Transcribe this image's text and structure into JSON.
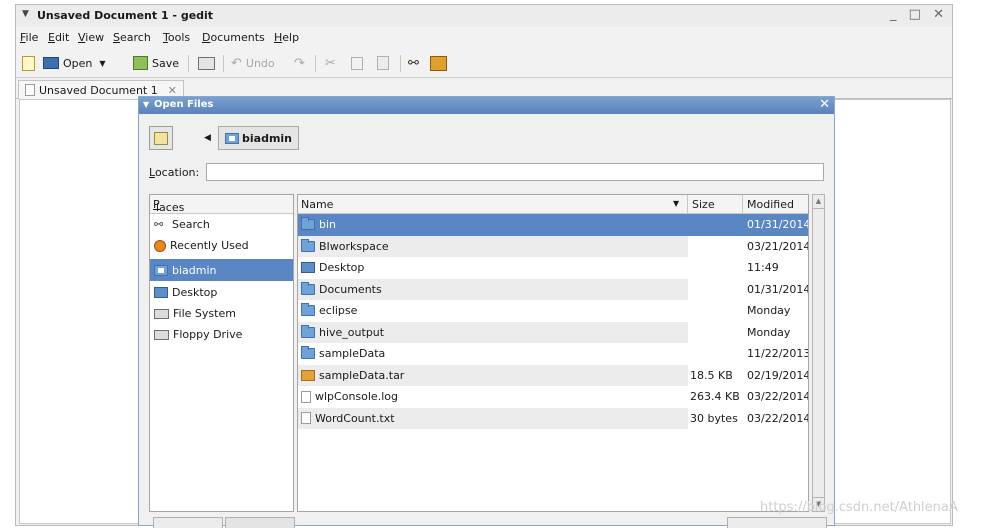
{
  "window": {
    "title": "Unsaved Document 1 - gedit",
    "controls": "_ □ ✕"
  },
  "menubar": [
    {
      "accel": "F",
      "rest": "ile"
    },
    {
      "accel": "E",
      "rest": "dit"
    },
    {
      "accel": "V",
      "rest": "iew"
    },
    {
      "accel": "S",
      "rest": "earch"
    },
    {
      "accel": "T",
      "rest": "ools"
    },
    {
      "accel": "D",
      "rest": "ocuments"
    },
    {
      "accel": "H",
      "rest": "elp"
    }
  ],
  "toolbar": {
    "open_label": "Open",
    "save_label": "Save",
    "undo_label": "Undo"
  },
  "tab": {
    "label": "Unsaved Document 1",
    "close": "✕"
  },
  "dialog": {
    "title": "Open Files",
    "close": "✕",
    "path_button": "biadmin",
    "location_label_accel": "L",
    "location_label_rest": "ocation:",
    "location_value": "",
    "places_header_accel": "P",
    "places_header_rest": "laces",
    "places": [
      {
        "label": "Search",
        "icon": "search-icon"
      },
      {
        "label": "Recently Used",
        "icon": "recent-icon"
      },
      {
        "label": "biadmin",
        "icon": "home-folder-icon",
        "selected": true
      },
      {
        "label": "Desktop",
        "icon": "desktop-icon"
      },
      {
        "label": "File System",
        "icon": "drive-icon"
      },
      {
        "label": "Floppy Drive",
        "icon": "drive-icon"
      }
    ],
    "columns": {
      "name": "Name",
      "size": "Size",
      "modified": "Modified"
    },
    "files": [
      {
        "name": "bin",
        "size": "",
        "modified": "01/31/2014",
        "icon": "folder-icon",
        "selected": true
      },
      {
        "name": "BIworkspace",
        "size": "",
        "modified": "03/21/2014",
        "icon": "folder-icon"
      },
      {
        "name": "Desktop",
        "size": "",
        "modified": "11:49",
        "icon": "desktop-icon"
      },
      {
        "name": "Documents",
        "size": "",
        "modified": "01/31/2014",
        "icon": "folder-icon"
      },
      {
        "name": "eclipse",
        "size": "",
        "modified": "Monday",
        "icon": "folder-icon"
      },
      {
        "name": "hive_output",
        "size": "",
        "modified": "Monday",
        "icon": "folder-icon"
      },
      {
        "name": "sampleData",
        "size": "",
        "modified": "11/22/2013",
        "icon": "folder-icon"
      },
      {
        "name": "sampleData.tar",
        "size": "18.5 KB",
        "modified": "02/19/2014",
        "icon": "archive-icon"
      },
      {
        "name": "wlpConsole.log",
        "size": "263.4 KB",
        "modified": "03/22/2014",
        "icon": "text-file-icon"
      },
      {
        "name": "WordCount.txt",
        "size": "30 bytes",
        "modified": "03/22/2014",
        "icon": "text-file-icon"
      }
    ]
  },
  "watermark": "https://blog.csdn.net/AthlenaA",
  "colors": {
    "selection": "#5a87c4",
    "dialog_title": "#5a83bb"
  }
}
